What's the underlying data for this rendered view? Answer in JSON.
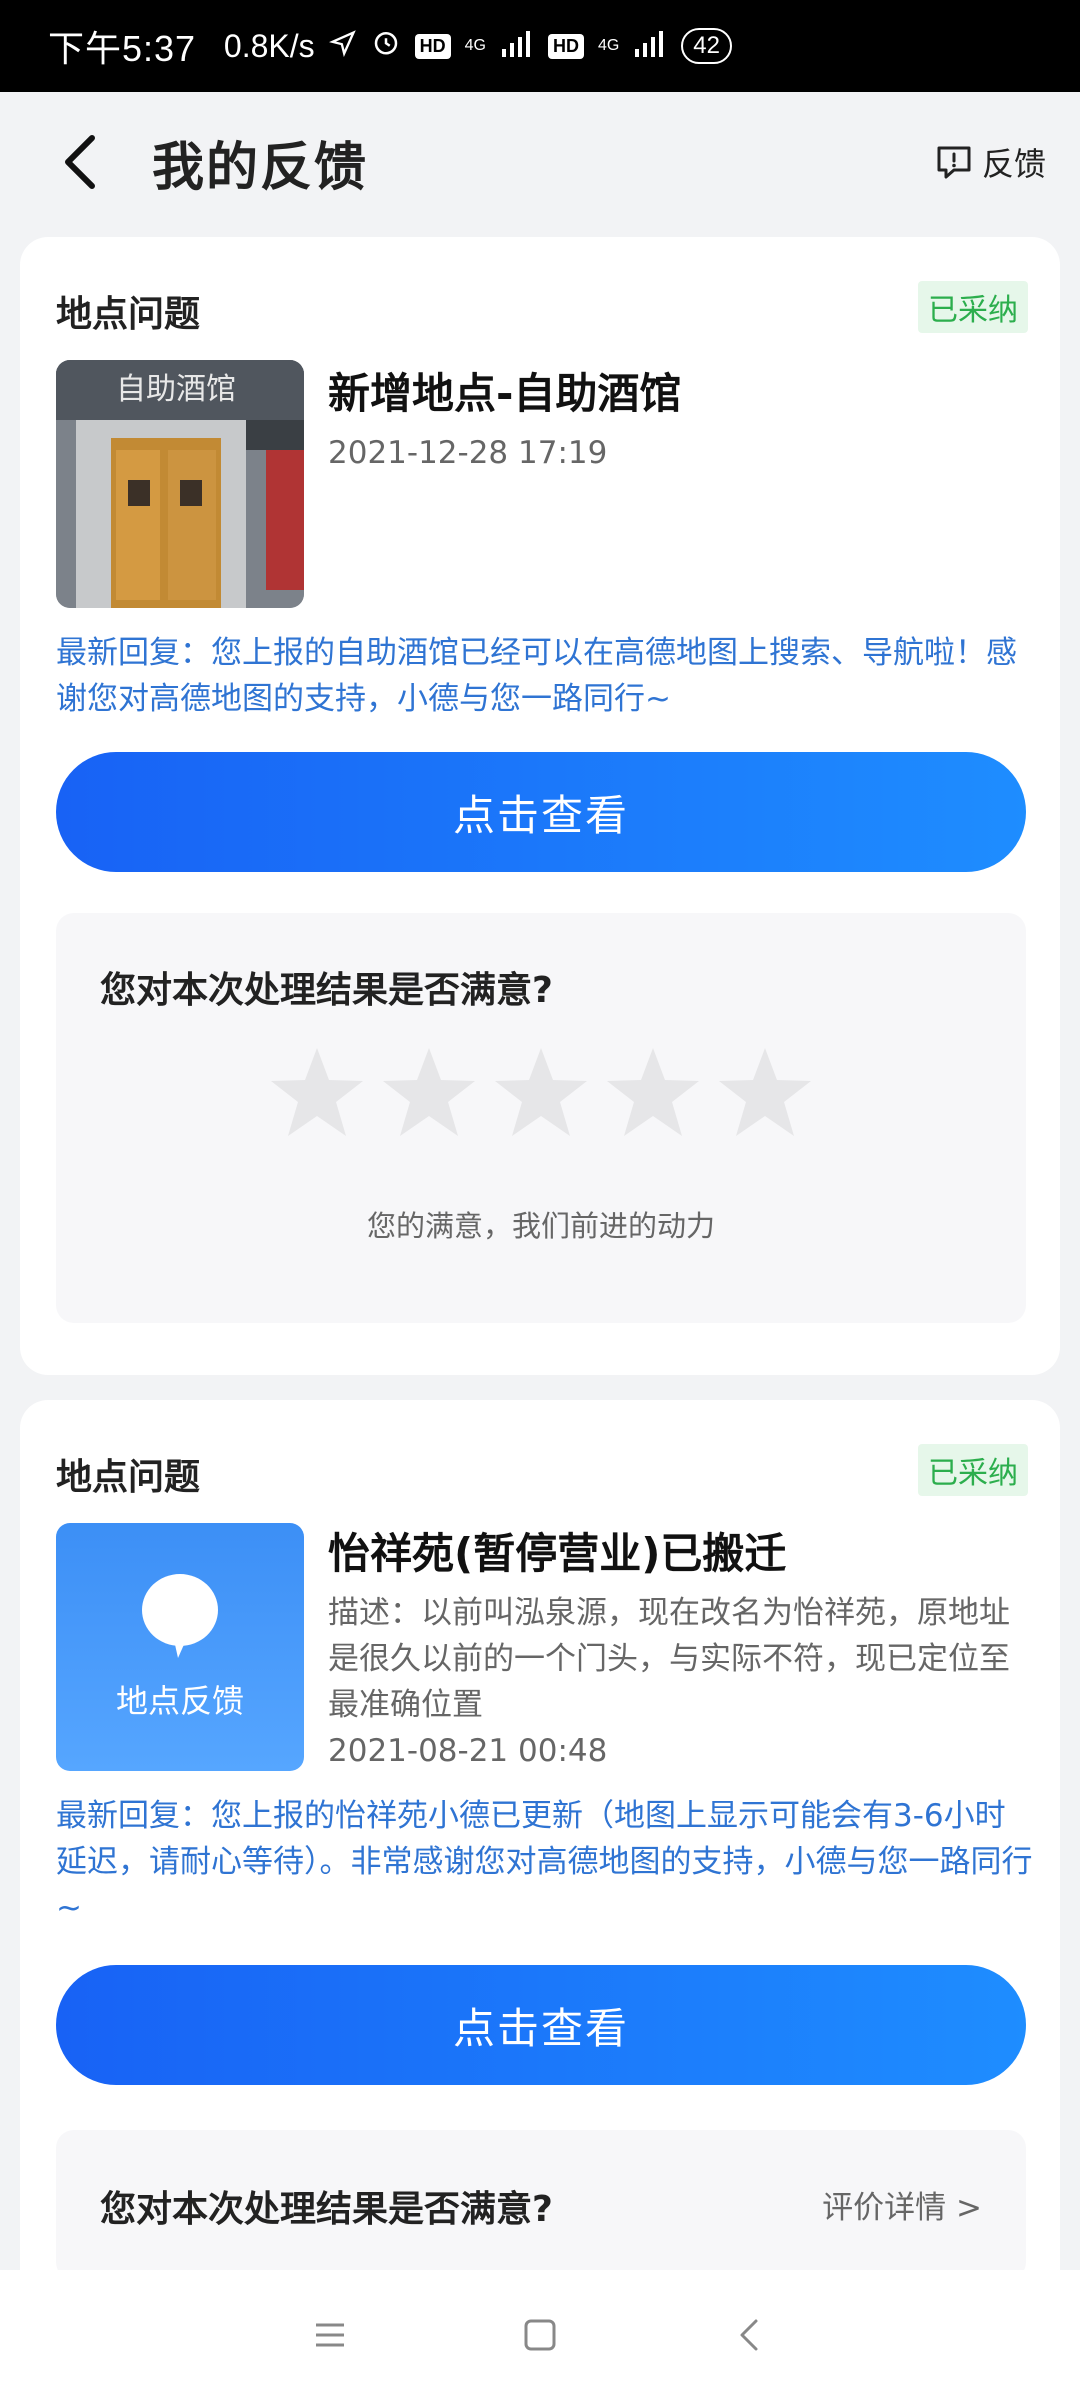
{
  "status_bar": {
    "time": "下午5:37",
    "speed": "0.8K/s",
    "hd1": "HD",
    "net1": "4G",
    "hd2": "HD",
    "net2": "4G",
    "battery": "42"
  },
  "header": {
    "title": "我的反馈",
    "feedback_label": "反馈"
  },
  "cards": [
    {
      "category": "地点问题",
      "status": "已采纳",
      "thumb_text": "自助酒馆",
      "title": "新增地点-自助酒馆",
      "date": "2021-12-28 17:19",
      "reply": "最新回复：您上报的自助酒馆已经可以在高德地图上搜索、导航啦！感谢您对高德地图的支持，小德与您一路同行~",
      "button": "点击查看",
      "rating_question": "您对本次处理结果是否满意?",
      "rating_tip": "您的满意，我们前进的动力"
    },
    {
      "category": "地点问题",
      "status": "已采纳",
      "thumb_text": "地点反馈",
      "title": "怡祥苑(暂停营业)已搬迁",
      "description": "描述：以前叫泓泉源，现在改名为怡祥苑，原地址是很久以前的一个门头，与实际不符，现已定位至最准确位置",
      "date": "2021-08-21 00:48",
      "reply": "最新回复：您上报的怡祥苑小德已更新（地图上显示可能会有3-6小时延迟，请耐心等待）。非常感谢您对高德地图的支持，小德与您一路同行~",
      "button": "点击查看",
      "rating_question": "您对本次处理结果是否满意?",
      "rating_detail": "评价详情 >"
    }
  ],
  "colors": {
    "accent": "#1E7BFF",
    "reply_text": "#2F74D3",
    "badge_green": "#2CAE4D",
    "badge_bg": "#E6F7EA"
  },
  "icons": [
    "back-icon",
    "feedback-icon",
    "star-icon",
    "pin-icon",
    "menu-icon",
    "home-icon",
    "nav-back-icon"
  ]
}
